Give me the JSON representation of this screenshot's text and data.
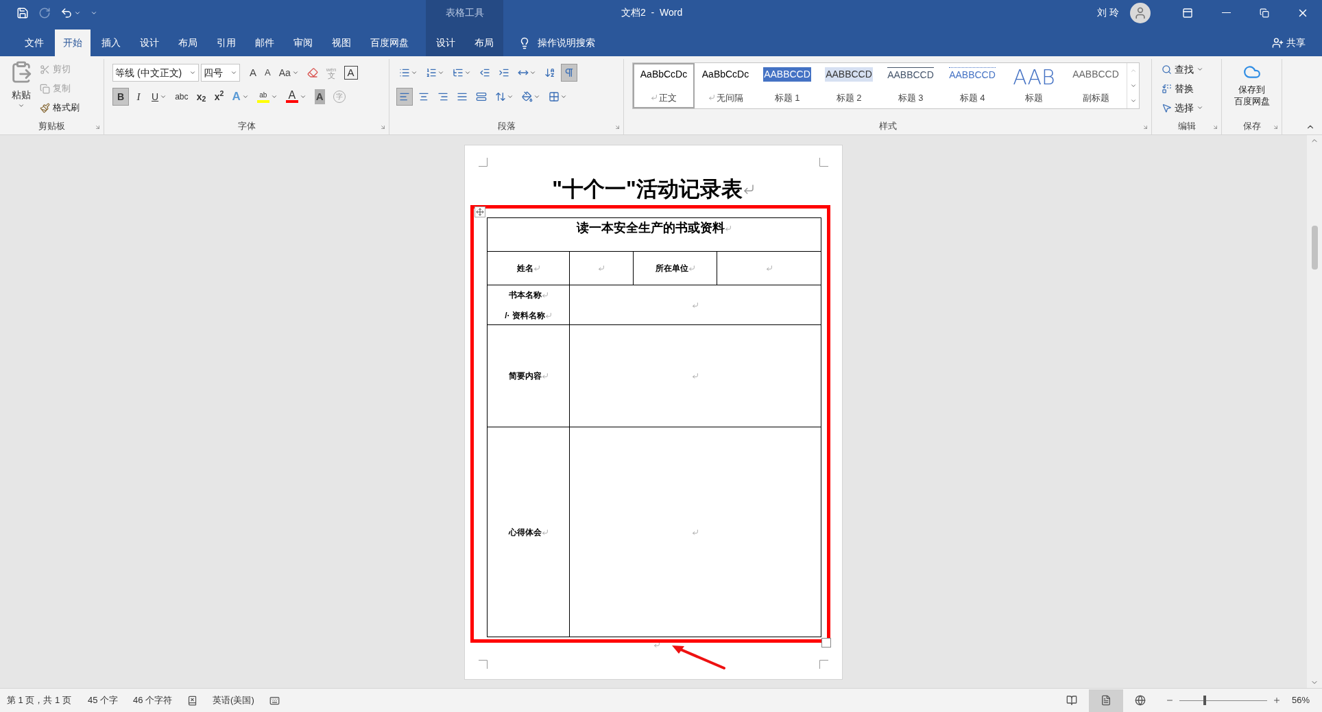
{
  "quick_access": [
    {
      "kind": "save",
      "disabled": false
    },
    {
      "kind": "redo",
      "disabled": true
    },
    {
      "kind": "undo",
      "disabled": false
    },
    {
      "kind": "customize",
      "disabled": false
    }
  ],
  "title_bar": {
    "contextual_group": "表格工具",
    "document_title": "文档2  -  Word",
    "user_name": "刘 玲"
  },
  "tabs": [
    {
      "label": "文件",
      "selected": false,
      "contextual": false
    },
    {
      "label": "开始",
      "selected": true,
      "contextual": false
    },
    {
      "label": "插入",
      "selected": false,
      "contextual": false
    },
    {
      "label": "设计",
      "selected": false,
      "contextual": false
    },
    {
      "label": "布局",
      "selected": false,
      "contextual": false
    },
    {
      "label": "引用",
      "selected": false,
      "contextual": false
    },
    {
      "label": "邮件",
      "selected": false,
      "contextual": false
    },
    {
      "label": "审阅",
      "selected": false,
      "contextual": false
    },
    {
      "label": "视图",
      "selected": false,
      "contextual": false
    },
    {
      "label": "百度网盘",
      "selected": false,
      "contextual": false
    },
    {
      "label": "设计",
      "selected": false,
      "contextual": true
    },
    {
      "label": "布局",
      "selected": false,
      "contextual": true
    }
  ],
  "tell_me": "操作说明搜索",
  "share": "共享",
  "clipboard": {
    "paste": "粘贴",
    "label": "剪贴板",
    "commands": [
      {
        "kind": "cut",
        "label": "剪切",
        "disabled": true
      },
      {
        "kind": "copy",
        "label": "复制",
        "disabled": true
      },
      {
        "kind": "format_painter",
        "label": "格式刷",
        "disabled": false
      }
    ]
  },
  "font": {
    "font_name": "等线 (中文正文)",
    "font_size": "四号",
    "label": "字体",
    "row1": [
      {
        "kind": "grow",
        "label": "A"
      },
      {
        "kind": "shrink",
        "label": "A"
      },
      {
        "kind": "case",
        "label": "Aa"
      },
      {
        "kind": "clear"
      },
      {
        "kind": "phonetic",
        "label": "文",
        "ruby": "wén"
      },
      {
        "kind": "border",
        "label": "A"
      }
    ],
    "row2": [
      {
        "kind": "bold",
        "label": "B",
        "pressed": true
      },
      {
        "kind": "italic",
        "label": "I",
        "pressed": false
      },
      {
        "kind": "underline",
        "label": "U",
        "pressed": false
      },
      {
        "kind": "strike",
        "label": "abc",
        "pressed": false
      },
      {
        "kind": "subscript",
        "label": "x$_{2}$",
        "pressed": false
      },
      {
        "kind": "superscript",
        "label": "x$^{2}$",
        "pressed": false
      },
      {
        "kind": "effects",
        "label": "A",
        "pressed": false
      },
      {
        "kind": "highlight",
        "label": "ab",
        "color": "#ffff00",
        "pressed": false
      },
      {
        "kind": "font_color",
        "label": "A",
        "color": "#ff0000",
        "pressed": false
      },
      {
        "kind": "shading",
        "label": "A",
        "pressed": false
      },
      {
        "kind": "enclose",
        "label": "字",
        "pressed": false
      }
    ]
  },
  "paragraph": {
    "label": "段落",
    "row1": [
      {
        "kind": "bullets",
        "pressed": false
      },
      {
        "kind": "numbering",
        "pressed": false
      },
      {
        "kind": "multilevel",
        "pressed": false
      },
      {
        "kind": "outdent",
        "pressed": false
      },
      {
        "kind": "indent",
        "pressed": false
      },
      {
        "kind": "asian_layout",
        "pressed": false
      },
      {
        "kind": "sort",
        "pressed": false
      },
      {
        "kind": "show_marks",
        "pressed": true
      }
    ],
    "row2": [
      {
        "kind": "align_left",
        "pressed": true
      },
      {
        "kind": "center",
        "pressed": false
      },
      {
        "kind": "align_right",
        "pressed": false
      },
      {
        "kind": "justify",
        "pressed": false
      },
      {
        "kind": "distributed",
        "pressed": false
      },
      {
        "kind": "line_spacing",
        "pressed": false
      },
      {
        "kind": "shading",
        "pressed": false
      },
      {
        "kind": "borders",
        "pressed": false
      }
    ]
  },
  "styles": {
    "label": "样式",
    "items": [
      {
        "kind": "normal",
        "preview": "AaBbCcDc",
        "name": "正文",
        "selected": true
      },
      {
        "kind": "no_spacing",
        "preview": "AaBbCcDc",
        "name": "无间隔",
        "selected": false
      },
      {
        "kind": "heading1",
        "preview": "AABBCCD",
        "name": "标题 1",
        "selected": false
      },
      {
        "kind": "heading2",
        "preview": "AABBCCD",
        "name": "标题 2",
        "selected": false
      },
      {
        "kind": "heading3",
        "preview": "AABBCCD",
        "name": "标题 3",
        "selected": false
      },
      {
        "kind": "heading4",
        "preview": "AABBCCD",
        "name": "标题 4",
        "selected": false
      },
      {
        "kind": "title",
        "preview": "AAB",
        "name": "标题",
        "selected": false
      },
      {
        "kind": "subtitle",
        "preview": "AABBCCD",
        "name": "副标题",
        "selected": false
      }
    ]
  },
  "editing": {
    "label": "编辑",
    "commands": [
      {
        "kind": "find",
        "label": "查找"
      },
      {
        "kind": "replace",
        "label": "替换"
      },
      {
        "kind": "select",
        "label": "选择"
      }
    ]
  },
  "save_group": {
    "button_lines": [
      "保存到",
      "百度网盘"
    ],
    "label": "保存"
  },
  "document": {
    "title": "\"十个一\"活动记录表",
    "table": {
      "heading": "读一本安全生产的书或资料",
      "rows": [
        {
          "kind": "pair",
          "cells": [
            "姓名",
            "所在单位"
          ]
        },
        {
          "kind": "wide",
          "lines": [
            "书本名称",
            "/· 资料名称"
          ]
        },
        {
          "kind": "wide",
          "lines": [
            "简要内容"
          ]
        },
        {
          "kind": "wide",
          "lines": [
            "心得体会"
          ]
        }
      ]
    }
  },
  "status_bar": {
    "page": "第 1 页，共 1 页",
    "words": "45 个字",
    "chars": "46 个字符",
    "language": "英语(美国)",
    "zoom": "56%",
    "zoom_slider": {
      "level": 0.29
    },
    "views": [
      {
        "kind": "read",
        "selected": false
      },
      {
        "kind": "print",
        "selected": true
      },
      {
        "kind": "web",
        "selected": false
      }
    ]
  }
}
